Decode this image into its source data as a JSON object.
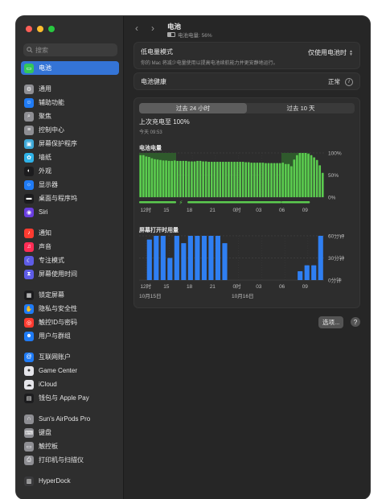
{
  "search": {
    "placeholder": "搜索"
  },
  "sidebar": {
    "groups": [
      [
        {
          "label": "电池",
          "icon": "battery-icon",
          "color": "#34c759",
          "selected": true
        }
      ],
      [
        {
          "label": "通用",
          "icon": "gear-icon",
          "color": "#8e8e93"
        },
        {
          "label": "辅助功能",
          "icon": "accessibility-icon",
          "color": "#1f7bf5"
        },
        {
          "label": "聚焦",
          "icon": "search-icon",
          "color": "#8e8e93"
        },
        {
          "label": "控制中心",
          "icon": "control-center-icon",
          "color": "#8e8e93"
        },
        {
          "label": "屏幕保护程序",
          "icon": "screensaver-icon",
          "color": "#3fa9d8"
        },
        {
          "label": "墙纸",
          "icon": "wallpaper-icon",
          "color": "#2fb2e8"
        },
        {
          "label": "外观",
          "icon": "appearance-icon",
          "color": "#1c1c1e"
        },
        {
          "label": "显示器",
          "icon": "display-icon",
          "color": "#1f7bf5"
        },
        {
          "label": "桌面与程序坞",
          "icon": "dock-icon",
          "color": "#1c1c1e"
        },
        {
          "label": "Siri",
          "icon": "siri-icon",
          "color": "#6a3ee0"
        }
      ],
      [
        {
          "label": "通知",
          "icon": "bell-icon",
          "color": "#ff3b30"
        },
        {
          "label": "声音",
          "icon": "speaker-icon",
          "color": "#ff2d55"
        },
        {
          "label": "专注模式",
          "icon": "moon-icon",
          "color": "#5e5ce6"
        },
        {
          "label": "屏幕使用时间",
          "icon": "hourglass-icon",
          "color": "#5e5ce6"
        }
      ],
      [
        {
          "label": "锁定屏幕",
          "icon": "lock-screen-icon",
          "color": "#1c1c1e"
        },
        {
          "label": "隐私与安全性",
          "icon": "hand-icon",
          "color": "#1f7bf5"
        },
        {
          "label": "触控ID与密码",
          "icon": "fingerprint-icon",
          "color": "#ff3b30"
        },
        {
          "label": "用户与群组",
          "icon": "users-icon",
          "color": "#1f7bf5"
        }
      ],
      [
        {
          "label": "互联网账户",
          "icon": "at-icon",
          "color": "#1f7bf5"
        },
        {
          "label": "Game Center",
          "icon": "game-center-icon",
          "color": "#e5e5ea"
        },
        {
          "label": "iCloud",
          "icon": "cloud-icon",
          "color": "#e5e5ea"
        },
        {
          "label": "钱包与 Apple Pay",
          "icon": "wallet-icon",
          "color": "#1c1c1e"
        }
      ],
      [
        {
          "label": "Sun's AirPods Pro",
          "icon": "airpods-icon",
          "color": "#8e8e93"
        },
        {
          "label": "键盘",
          "icon": "keyboard-icon",
          "color": "#8e8e93"
        },
        {
          "label": "触控板",
          "icon": "trackpad-icon",
          "color": "#8e8e93"
        },
        {
          "label": "打印机与扫描仪",
          "icon": "printer-icon",
          "color": "#8e8e93"
        }
      ],
      [
        {
          "label": "HyperDock",
          "icon": "hyperdock-icon",
          "color": "#3a3a3c"
        }
      ]
    ]
  },
  "header": {
    "title": "电池",
    "subtitle": "电池电量: 56%"
  },
  "low_power": {
    "title": "低电量模式",
    "desc": "你的 Mac 将减少电量使用以提高电池续航能力并更安静地运行。",
    "value": "仅使用电池时"
  },
  "health": {
    "title": "电池健康",
    "value": "正常"
  },
  "usage": {
    "tabs": [
      "过去 24 小时",
      "过去 10 天"
    ],
    "active_tab": 0,
    "last_charge_title": "上次充电至 100%",
    "last_charge_time": "今天 09:53",
    "level_title": "电池电量",
    "screen_title": "屏幕打开时用量",
    "x_ticks": [
      "12时",
      "15",
      "18",
      "21",
      "0时",
      "03",
      "06",
      "09"
    ],
    "date_left": "10月15日",
    "date_right": "10月16日"
  },
  "chart_data": [
    {
      "type": "bar",
      "title": "电池电量",
      "x": [
        "12时",
        "15",
        "18",
        "21",
        "0时",
        "03",
        "06",
        "09"
      ],
      "y_ticks": [
        "100%",
        "50%",
        "0%"
      ],
      "ylim": [
        0,
        100
      ],
      "values": [
        95,
        95,
        92,
        91,
        88,
        86,
        85,
        84,
        83,
        83,
        82,
        82,
        83,
        82,
        82,
        82,
        82,
        81,
        81,
        81,
        82,
        82,
        81,
        81,
        80,
        80,
        80,
        80,
        80,
        80,
        80,
        80,
        80,
        80,
        80,
        80,
        80,
        79,
        79,
        78,
        78,
        78,
        78,
        78,
        77,
        77,
        77,
        77,
        77,
        77,
        78,
        75,
        75,
        70,
        85,
        95,
        100,
        100,
        100,
        98,
        95,
        90,
        84,
        72,
        55
      ],
      "charging_shaded_ranges": [
        [
          0,
          13
        ],
        [
          50,
          60
        ]
      ],
      "colors": {
        "battery": "#5bcb4f",
        "charging_bg": "#2f5a2c"
      }
    },
    {
      "type": "bar",
      "title": "屏幕打开时用量",
      "x": [
        "12时",
        "15",
        "18",
        "21",
        "0时",
        "03",
        "06",
        "09"
      ],
      "y_ticks": [
        "60分钟",
        "30分钟",
        "0分钟"
      ],
      "ylim": [
        0,
        60
      ],
      "values": [
        0,
        55,
        60,
        60,
        30,
        60,
        50,
        60,
        60,
        60,
        60,
        60,
        50,
        0,
        0,
        0,
        0,
        0,
        0,
        0,
        0,
        0,
        0,
        12,
        20,
        20,
        60
      ],
      "colors": {
        "bar": "#2f7ff2"
      }
    }
  ],
  "footer": {
    "options_label": "选项...",
    "help_label": "?"
  }
}
